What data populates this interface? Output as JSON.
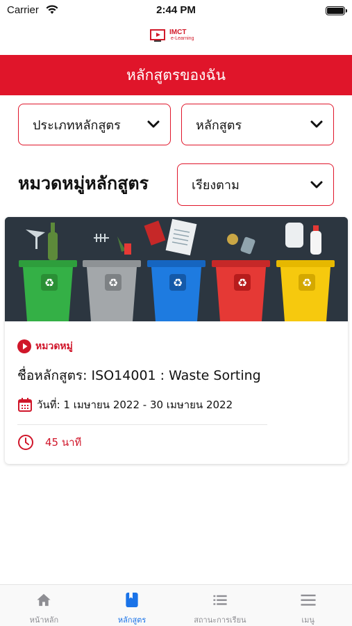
{
  "status_bar": {
    "carrier": "Carrier",
    "time": "2:44 PM"
  },
  "logo": {
    "text": "IMCT",
    "subtext": "e-Learning"
  },
  "header": {
    "title": "หลักสูตรของฉัน"
  },
  "filters": {
    "course_type": "ประเภทหลักสูตร",
    "course": "หลักสูตร",
    "sort": "เรียงตาม"
  },
  "section_title": "หมวดหมู่หลักสูตร",
  "course_card": {
    "category": "หมวดหมู่",
    "name": "ชื่อหลักสูตร: ISO14001 : Waste Sorting",
    "date": "วันที่: 1 เมษายน 2022 - 30 เมษายน 2022",
    "duration": "45 นาที"
  },
  "tabbar": {
    "items": [
      {
        "label": "หน้าหลัก",
        "icon": "home-icon"
      },
      {
        "label": "หลักสูตร",
        "icon": "book-icon"
      },
      {
        "label": "สถานะการเรียน",
        "icon": "list-icon"
      },
      {
        "label": "เมนู",
        "icon": "menu-icon"
      }
    ],
    "active_index": 1
  },
  "colors": {
    "brand_red": "#e0152a",
    "tab_active": "#1a73e8",
    "tab_inactive": "#8e8e93"
  }
}
